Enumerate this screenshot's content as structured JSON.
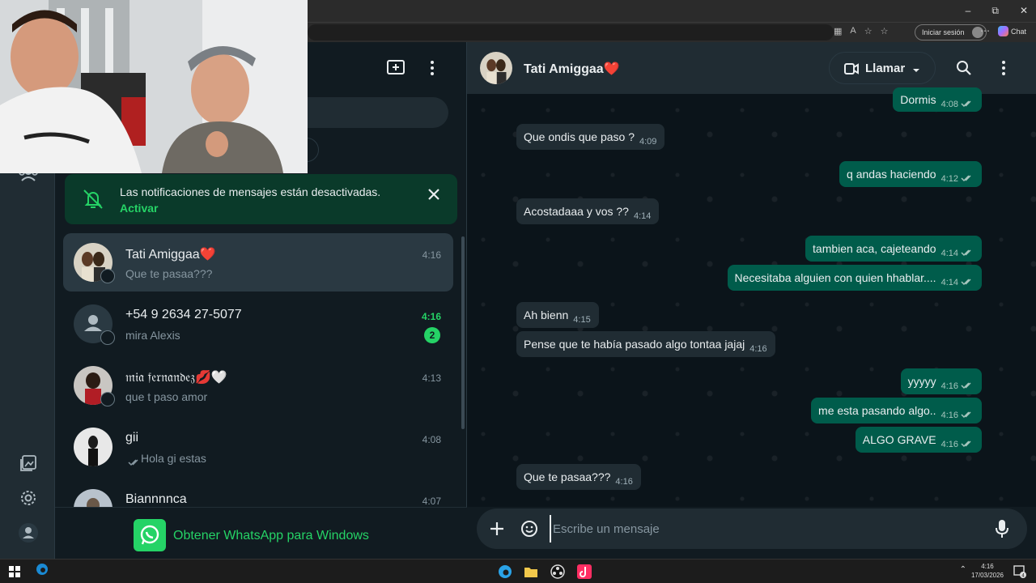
{
  "browser": {
    "signin_label": "Iniciar sesión",
    "chat_label": "Chat"
  },
  "sidebar": {
    "notification": {
      "text": "Las notificaciones de mensajes están desactivadas.",
      "link": "Activar"
    },
    "chats": [
      {
        "name": "Tati Amiggaa❤️",
        "time": "4:16",
        "preview": "Que te pasaa???",
        "active": true
      },
      {
        "name": "+54 9 2634 27-5077",
        "time": "4:16",
        "preview": "mira Alexis",
        "unread": "2"
      },
      {
        "name": "𝔪𝔦𝔞 𝔣𝔢𝔯𝔫𝔞𝔫𝔡𝔢𝔷💋🤍",
        "time": "4:13",
        "preview": "que t paso amor"
      },
      {
        "name": "gii",
        "time": "4:08",
        "preview": "Hola gi estas"
      },
      {
        "name": "Biannnnca",
        "time": "4:07",
        "preview": ""
      }
    ],
    "get_app": "Obtener WhatsApp para Windows"
  },
  "conversation": {
    "contact_name": "Tati Amiggaa❤️",
    "call_label": "Llamar",
    "messages": [
      {
        "dir": "out",
        "text": "Dormis",
        "time": "4:08"
      },
      {
        "dir": "in",
        "text": "Que ondis que paso ?",
        "time": "4:09"
      },
      {
        "dir": "out",
        "text": "q andas haciendo",
        "time": "4:12"
      },
      {
        "dir": "in",
        "text": "Acostadaaa y vos ??",
        "time": "4:14"
      },
      {
        "dir": "out",
        "text": "tambien aca, cajeteando",
        "time": "4:14"
      },
      {
        "dir": "out",
        "text": "Necesitaba alguien con quien hhablar....",
        "time": "4:14"
      },
      {
        "dir": "in",
        "text": "Ah bienn",
        "time": "4:15"
      },
      {
        "dir": "in",
        "text": "Pense que te había pasado algo tontaa jajaj",
        "time": "4:16"
      },
      {
        "dir": "out",
        "text": "yyyyy",
        "time": "4:16"
      },
      {
        "dir": "out",
        "text": "me esta pasando algo..",
        "time": "4:16"
      },
      {
        "dir": "out",
        "text": "ALGO GRAVE",
        "time": "4:16"
      },
      {
        "dir": "in",
        "text": "Que te pasaa???",
        "time": "4:16"
      }
    ],
    "composer_placeholder": "Escribe un mensaje"
  },
  "taskbar": {
    "time": "4:16",
    "date": "17/03/2026",
    "notif_count": "4"
  },
  "colors": {
    "accent": "#25d366",
    "bubble_out": "#005c4b",
    "bubble_in": "#202c33",
    "background": "#0b141a"
  }
}
